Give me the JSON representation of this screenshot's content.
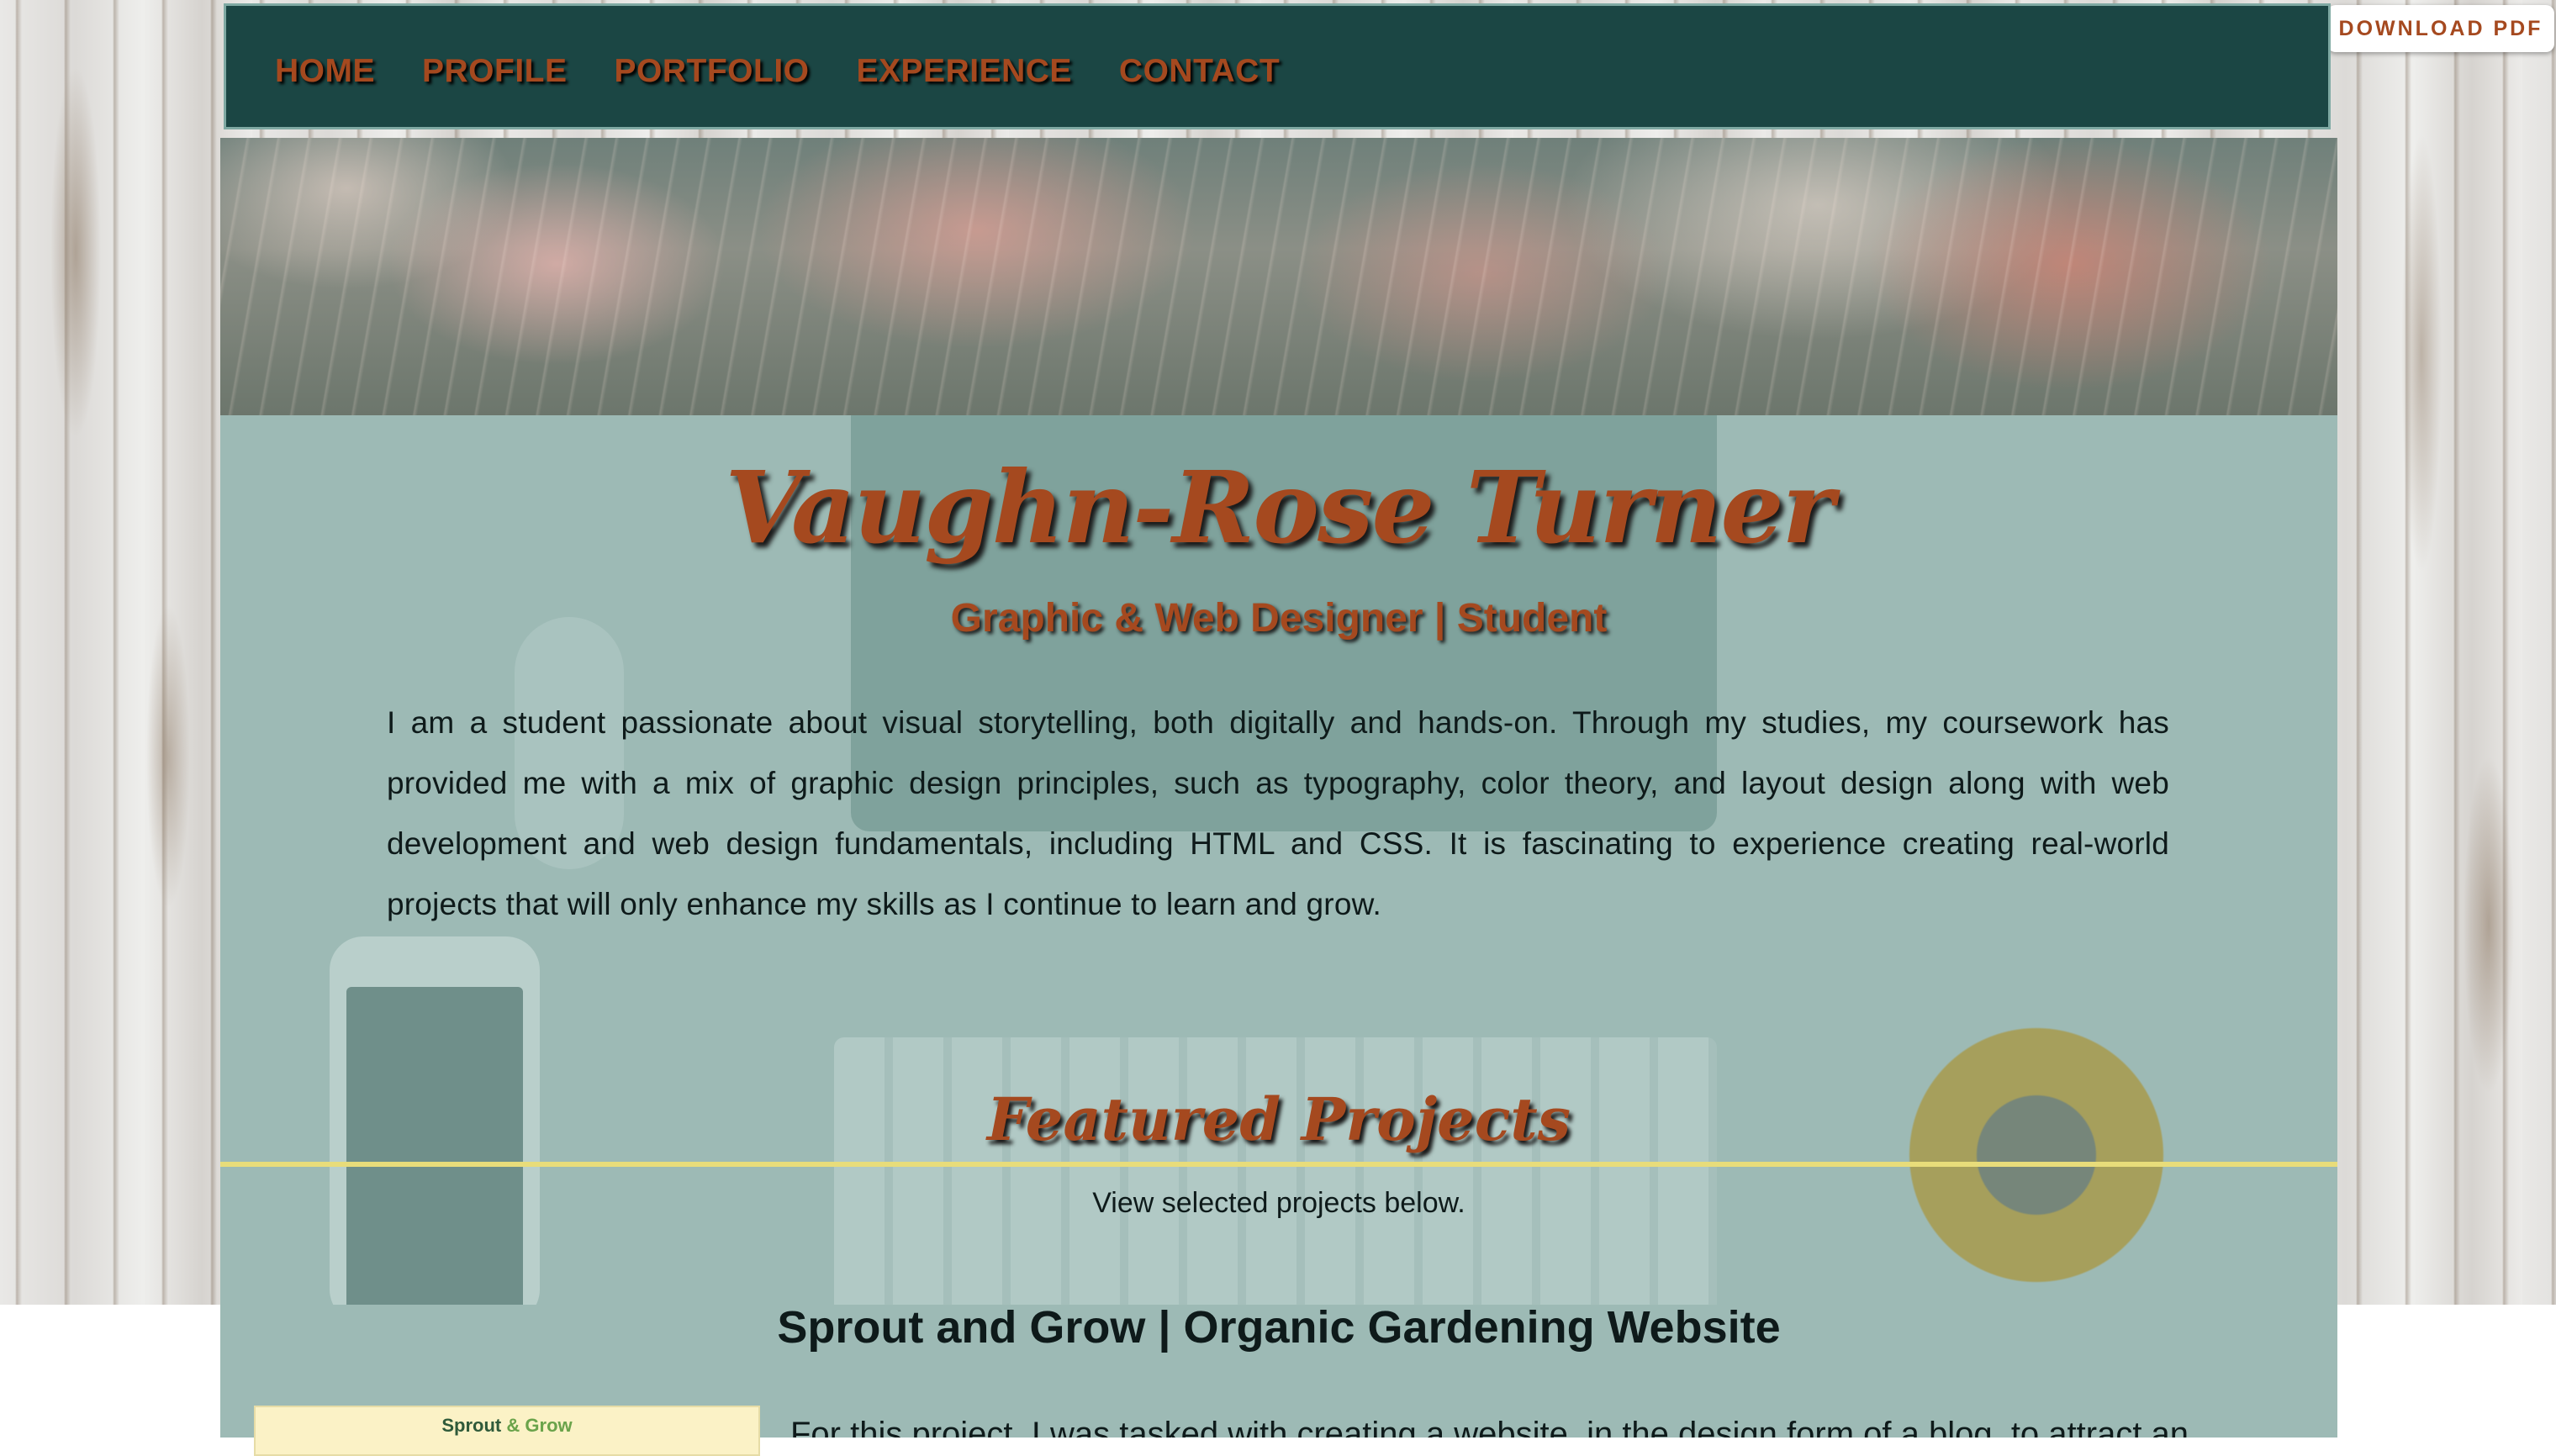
{
  "nav": {
    "items": [
      {
        "label": "HOME"
      },
      {
        "label": "PROFILE"
      },
      {
        "label": "PORTFOLIO"
      },
      {
        "label": "EXPERIENCE"
      },
      {
        "label": "CONTACT"
      }
    ]
  },
  "download_button": {
    "label": "DOWNLOAD PDF"
  },
  "header": {
    "name": "Vaughn-Rose Turner",
    "subtitle": "Graphic & Web Designer | Student"
  },
  "intro": {
    "text": "I am a student passionate about visual storytelling, both digitally and hands-on. Through my studies, my coursework has provided me with a mix of graphic design principles, such as typography, color theory, and layout design along with web development and web design fundamentals, including HTML and CSS. It is fascinating to experience creating real-world projects that will only enhance my skills as I continue to learn and grow."
  },
  "featured": {
    "title": "Featured Projects",
    "subtitle": "View selected projects below."
  },
  "project": {
    "title": "Sprout and Grow | Organic Gardening Website",
    "thumb_logo_part1": "Sprout",
    "thumb_logo_part2": "& Grow",
    "description_visible": "For this project, I was tasked with creating a website, in the design form of a blog, to attract an"
  },
  "colors": {
    "nav_bg": "#1b4644",
    "accent_rust": "#a5491f",
    "panel_teal": "#9dbab5",
    "divider_yellow": "#e8dc7a"
  }
}
